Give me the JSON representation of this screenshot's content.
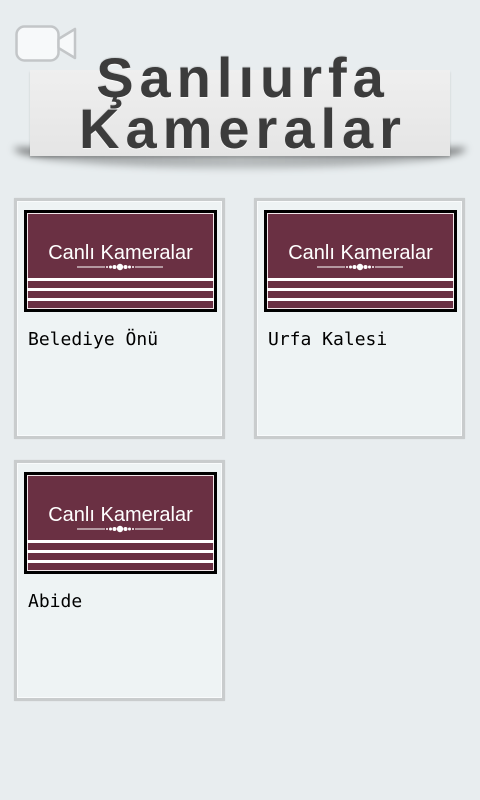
{
  "header": {
    "icon": "video-camera-icon",
    "title_line1": "Şanlıurfa",
    "title_line2": "Kameralar"
  },
  "cameras": [
    {
      "thumbnail_text": "Canlı Kameralar",
      "label": "Belediye Önü"
    },
    {
      "thumbnail_text": "Canlı Kameralar",
      "label": "Urfa Kalesi"
    },
    {
      "thumbnail_text": "Canlı Kameralar",
      "label": "Abide"
    }
  ],
  "colors": {
    "page_bg": "#e8edef",
    "card_bg": "#eef3f4",
    "card_border": "#c9cccd",
    "thumbnail_bg": "#6a3043",
    "title_text": "#3c3c3c"
  }
}
